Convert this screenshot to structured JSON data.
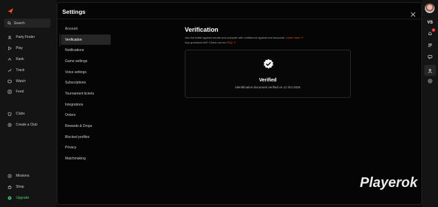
{
  "left_nav": {
    "search_label": "Search",
    "items": [
      {
        "label": "Party Finder",
        "icon": "party-icon"
      },
      {
        "label": "Play",
        "icon": "play-icon"
      },
      {
        "label": "Rank",
        "icon": "rank-icon"
      },
      {
        "label": "Track",
        "icon": "track-icon"
      },
      {
        "label": "Watch",
        "icon": "watch-icon"
      },
      {
        "label": "Feed",
        "icon": "feed-icon"
      },
      {
        "label": "Clubs",
        "icon": "clubs-icon"
      },
      {
        "label": "Create a Club",
        "icon": "plus-circle-icon"
      },
      {
        "label": "Missions",
        "icon": "missions-icon"
      },
      {
        "label": "Shop",
        "icon": "shop-icon"
      },
      {
        "label": "Upgrade",
        "icon": "upgrade-icon"
      }
    ]
  },
  "modal": {
    "title": "Settings",
    "settings_items": [
      "Account",
      "Verification",
      "Notifications",
      "Game settings",
      "Voice settings",
      "Subscriptions",
      "Tournament tickets",
      "Integrations",
      "Orders",
      "Rewards & Drops",
      "Blocked profiles",
      "Privacy",
      "Matchmaking"
    ],
    "active_item": "Verification",
    "content": {
      "heading": "Verification",
      "desc_line1": "Join the battle against smurfs and compete with confidence against real accounts.",
      "learn_more": "Learn more",
      "desc_line2": "Any questions left? Check out our",
      "faq": "FAQ",
      "card_title": "Verified",
      "card_subtitle": "Identification document verified on 12 Oct 2025"
    }
  },
  "right_rail": {
    "vs_label": "VS",
    "notification_count": "1"
  },
  "watermark": "Playerok",
  "colors": {
    "accent": "#ff5a1f",
    "upgrade_green": "#44d36a",
    "notification_red": "#e02a2a"
  }
}
